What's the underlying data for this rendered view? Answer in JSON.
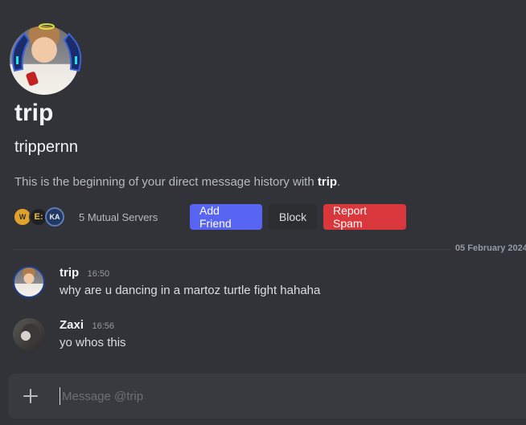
{
  "profile": {
    "display_name": "trip",
    "username": "trippernn",
    "intro_prefix": "This is the beginning of your direct message history with ",
    "intro_name": "trip",
    "intro_suffix": ".",
    "mutual_servers": "5 Mutual Servers",
    "server_icon_labels": [
      "W",
      "E:",
      "KA"
    ]
  },
  "actions": {
    "add_friend": "Add Friend",
    "block": "Block",
    "report_spam": "Report Spam"
  },
  "divider": {
    "date": "05 February 2024"
  },
  "messages": [
    {
      "author": "trip",
      "time": "16:50",
      "text": "why are u dancing in a martoz turtle fight hahaha"
    },
    {
      "author": "Zaxi",
      "time": "16:56",
      "text": "yo whos this"
    }
  ],
  "composer": {
    "placeholder": "Message @trip"
  },
  "colors": {
    "background": "#313338",
    "blurple": "#5865f2",
    "danger": "#da373c",
    "composer": "#383a40"
  }
}
